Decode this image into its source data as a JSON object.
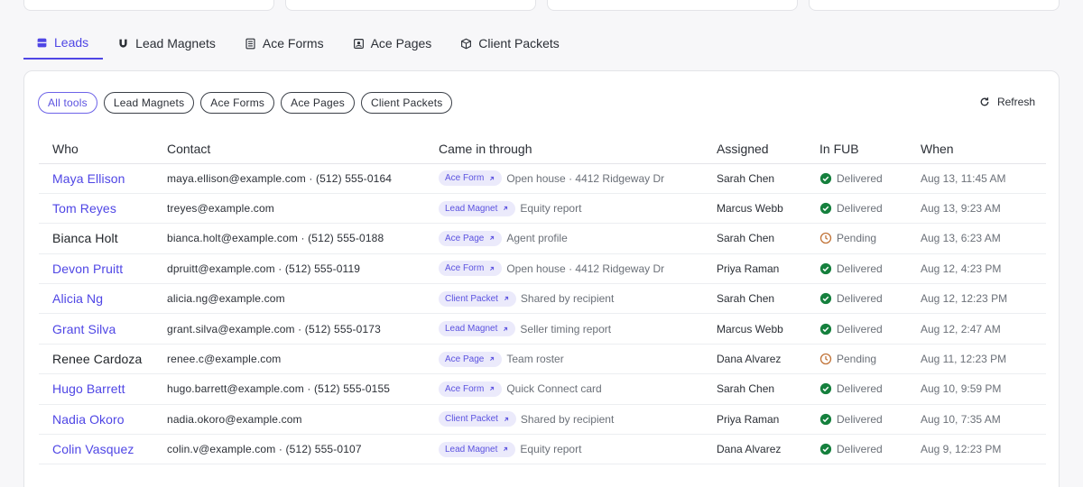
{
  "tabs": [
    {
      "label": "Leads",
      "icon": "inbox-icon",
      "active": true
    },
    {
      "label": "Lead Magnets",
      "icon": "magnet-icon",
      "active": false
    },
    {
      "label": "Ace Forms",
      "icon": "form-icon",
      "active": false
    },
    {
      "label": "Ace Pages",
      "icon": "page-icon",
      "active": false
    },
    {
      "label": "Client Packets",
      "icon": "package-icon",
      "active": false
    }
  ],
  "filters": [
    {
      "label": "All tools",
      "active": true
    },
    {
      "label": "Lead Magnets",
      "active": false
    },
    {
      "label": "Ace Forms",
      "active": false
    },
    {
      "label": "Ace Pages",
      "active": false
    },
    {
      "label": "Client Packets",
      "active": false
    }
  ],
  "refresh_label": "Refresh",
  "columns": [
    "Who",
    "Contact",
    "Came in through",
    "Assigned",
    "In FUB",
    "When"
  ],
  "rows": [
    {
      "who": "Maya Ellison",
      "linked": true,
      "contact": "maya.ellison@example.com · (512) 555-0164",
      "tool": "Ace Form",
      "source": "Open house · 4412 Ridgeway Dr",
      "assigned": "Sarah Chen",
      "status": "Delivered",
      "when": "Aug 13, 11:45 AM"
    },
    {
      "who": "Tom Reyes",
      "linked": true,
      "contact": "treyes@example.com",
      "tool": "Lead Magnet",
      "source": "Equity report",
      "assigned": "Marcus Webb",
      "status": "Delivered",
      "when": "Aug 13, 9:23 AM"
    },
    {
      "who": "Bianca Holt",
      "linked": false,
      "contact": "bianca.holt@example.com · (512) 555-0188",
      "tool": "Ace Page",
      "source": "Agent profile",
      "assigned": "Sarah Chen",
      "status": "Pending",
      "when": "Aug 13, 6:23 AM"
    },
    {
      "who": "Devon Pruitt",
      "linked": true,
      "contact": "dpruitt@example.com · (512) 555-0119",
      "tool": "Ace Form",
      "source": "Open house · 4412 Ridgeway Dr",
      "assigned": "Priya Raman",
      "status": "Delivered",
      "when": "Aug 12, 4:23 PM"
    },
    {
      "who": "Alicia Ng",
      "linked": true,
      "contact": "alicia.ng@example.com",
      "tool": "Client Packet",
      "source": "Shared by recipient",
      "assigned": "Sarah Chen",
      "status": "Delivered",
      "when": "Aug 12, 12:23 PM"
    },
    {
      "who": "Grant Silva",
      "linked": true,
      "contact": "grant.silva@example.com · (512) 555-0173",
      "tool": "Lead Magnet",
      "source": "Seller timing report",
      "assigned": "Marcus Webb",
      "status": "Delivered",
      "when": "Aug 12, 2:47 AM"
    },
    {
      "who": "Renee Cardoza",
      "linked": false,
      "contact": "renee.c@example.com",
      "tool": "Ace Page",
      "source": "Team roster",
      "assigned": "Dana Alvarez",
      "status": "Pending",
      "when": "Aug 11, 12:23 PM"
    },
    {
      "who": "Hugo Barrett",
      "linked": true,
      "contact": "hugo.barrett@example.com · (512) 555-0155",
      "tool": "Ace Form",
      "source": "Quick Connect card",
      "assigned": "Sarah Chen",
      "status": "Delivered",
      "when": "Aug 10, 9:59 PM"
    },
    {
      "who": "Nadia Okoro",
      "linked": true,
      "contact": "nadia.okoro@example.com",
      "tool": "Client Packet",
      "source": "Shared by recipient",
      "assigned": "Priya Raman",
      "status": "Delivered",
      "when": "Aug 10, 7:35 AM"
    },
    {
      "who": "Colin Vasquez",
      "linked": true,
      "contact": "colin.v@example.com · (512) 555-0107",
      "tool": "Lead Magnet",
      "source": "Equity report",
      "assigned": "Dana Alvarez",
      "status": "Delivered",
      "when": "Aug 9, 12:23 PM"
    }
  ],
  "colors": {
    "accent": "#4f46e5",
    "delivered": "#15803d",
    "pending": "#c2753a",
    "badge_bg": "#ebeafb"
  }
}
